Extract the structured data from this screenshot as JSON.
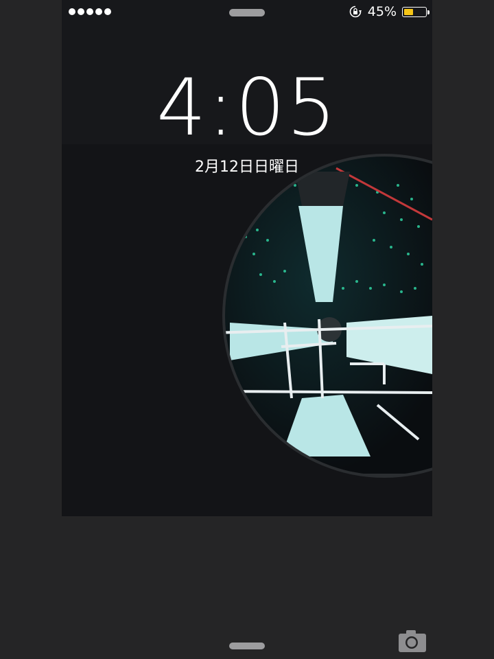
{
  "status_bar": {
    "signal_dots": 5,
    "battery_percent_label": "45%",
    "battery_level": 0.45,
    "battery_color": "#f5c517",
    "rotation_lock_icon": "orientation-lock-icon"
  },
  "lock_screen": {
    "time": "4:05",
    "date": "2月12日日曜日"
  },
  "controls": {
    "camera_icon": "camera-icon"
  },
  "colors": {
    "background": "#252526",
    "handle": "#9d9d9f",
    "crowd_accent": "#2fd1a0"
  }
}
